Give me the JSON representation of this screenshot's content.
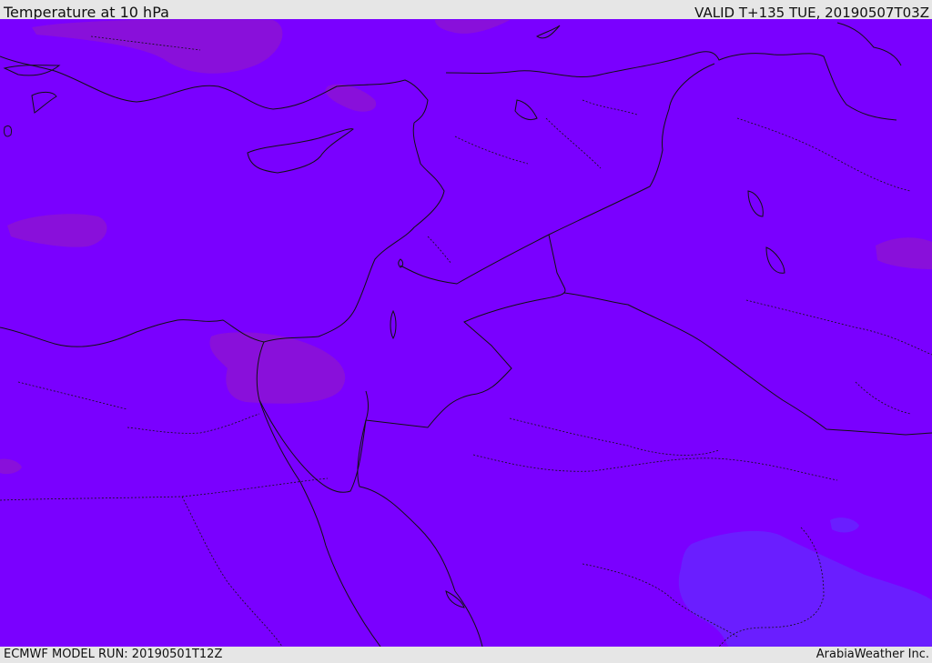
{
  "header": {
    "title": "Temperature at 10 hPa",
    "valid": "VALID T+135 TUE, 20190507T03Z"
  },
  "footer": {
    "model_run": "ECMWF MODEL RUN: 20190501T12Z",
    "credit": "ArabiaWeather Inc."
  },
  "colors": {
    "field_base": "#7a00ff",
    "warmer_patch": "#8a10d8",
    "cooler_patch": "#6a1aff",
    "coastline": "#111111"
  }
}
